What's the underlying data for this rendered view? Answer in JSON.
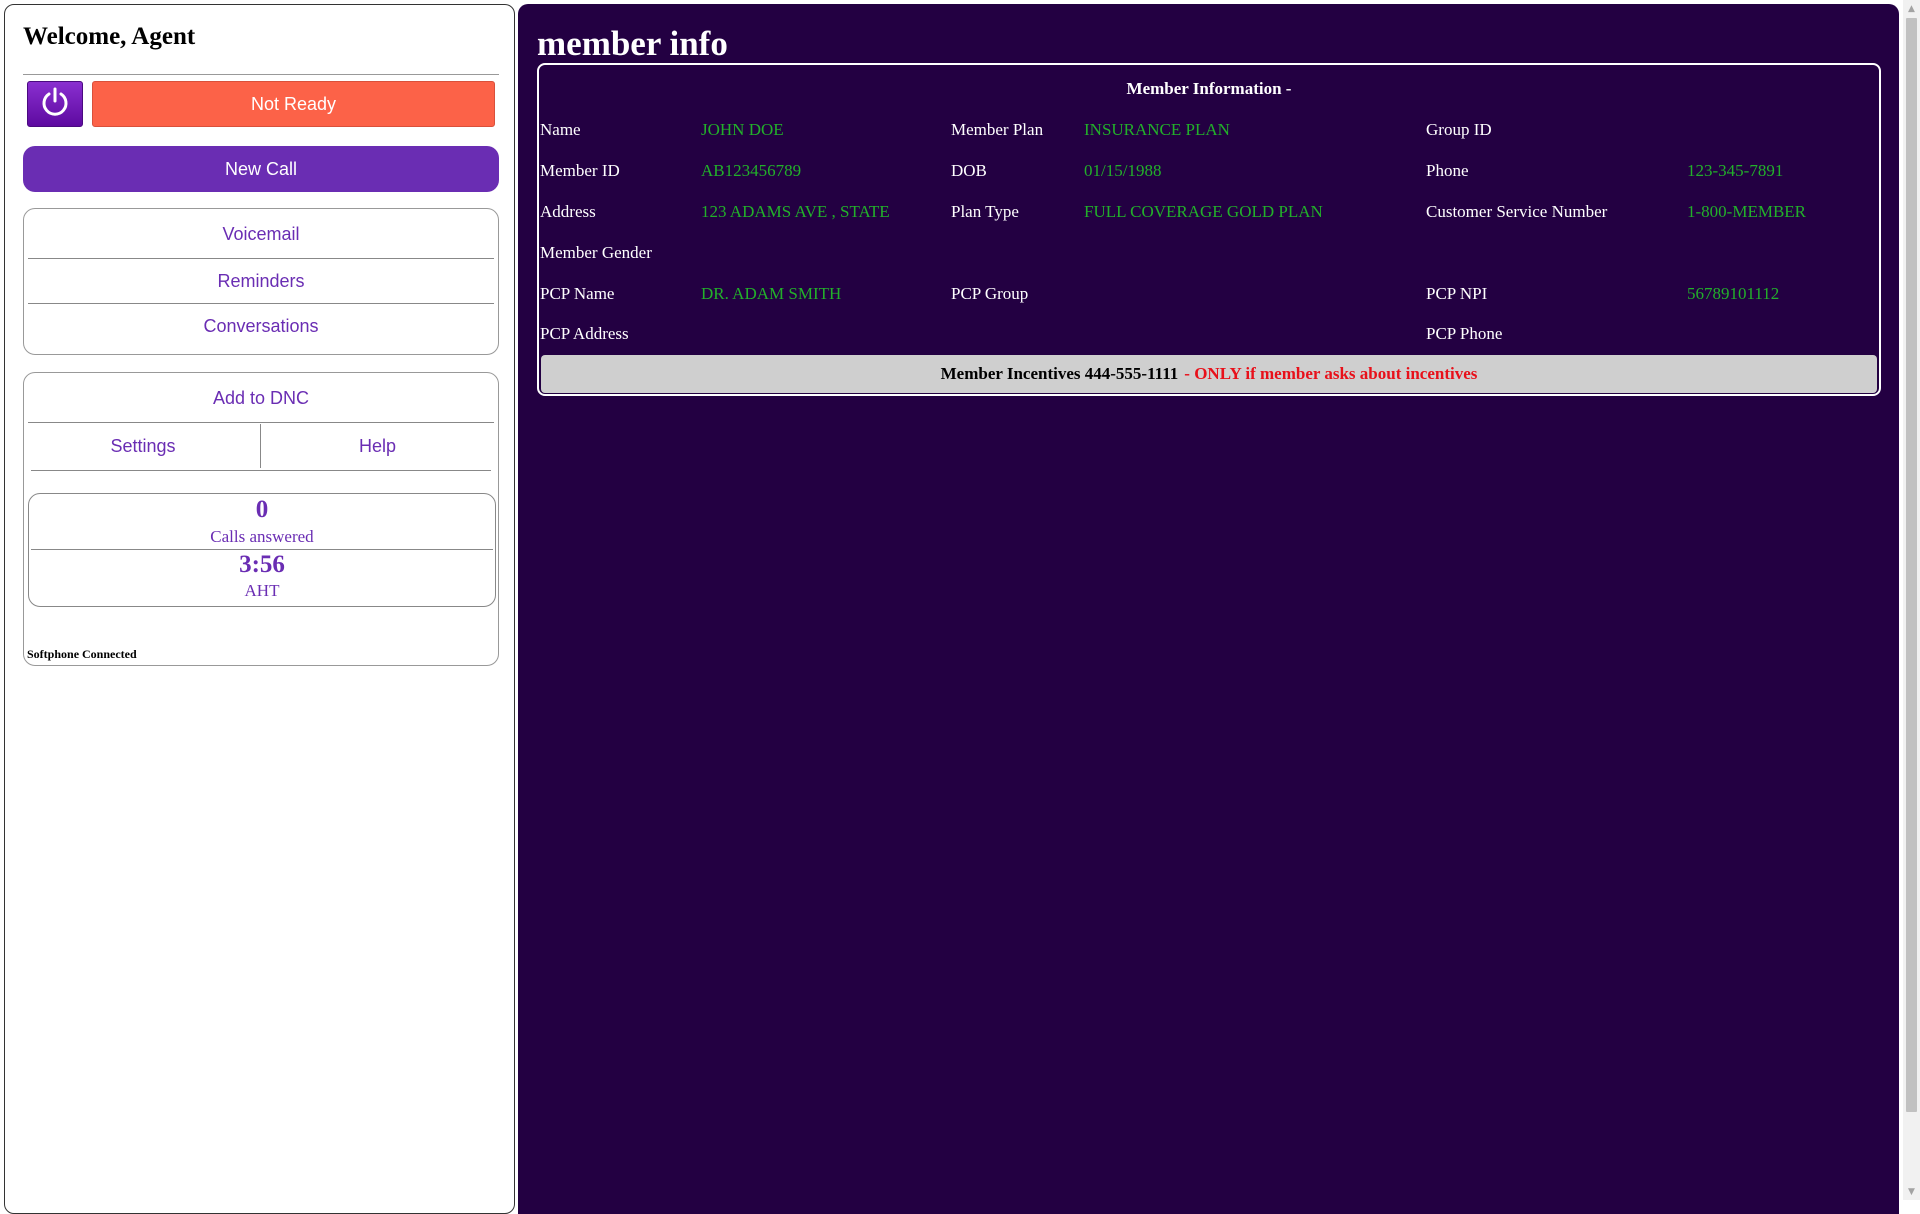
{
  "agent_panel": {
    "welcome": "Welcome, Agent",
    "status_button": "Not Ready",
    "new_call_button": "New Call",
    "menu": {
      "voicemail": "Voicemail",
      "reminders": "Reminders",
      "conversations": "Conversations"
    },
    "tools": {
      "add_dnc": "Add to DNC",
      "settings": "Settings",
      "help": "Help"
    },
    "stats": {
      "calls_answered_value": "0",
      "calls_answered_label": "Calls answered",
      "aht_value": "3:56",
      "aht_label": "AHT"
    },
    "softphone_status": "Softphone Connected",
    "colors": {
      "accent": "#6a2db3",
      "not_ready": "#fc6248",
      "power": "#7a1fc0"
    },
    "icons": {
      "power": "power-icon"
    }
  },
  "member_panel": {
    "title": "member info",
    "card_heading": "Member Information -",
    "fields": {
      "name_label": "Name",
      "name_value": "JOHN DOE",
      "member_plan_label": "Member Plan",
      "member_plan_value": "INSURANCE PLAN",
      "group_id_label": "Group ID",
      "group_id_value": "",
      "member_id_label": "Member ID",
      "member_id_value": "AB123456789",
      "dob_label": "DOB",
      "dob_value": "01/15/1988",
      "phone_label": "Phone",
      "phone_value": "123-345-7891",
      "address_label": "Address",
      "address_value": "123 ADAMS AVE , STATE",
      "plan_type_label": "Plan Type",
      "plan_type_value": "FULL COVERAGE GOLD PLAN",
      "csn_label": "Customer Service Number",
      "csn_value": "1-800-MEMBER",
      "gender_label": "Member Gender",
      "gender_value": "",
      "pcp_name_label": "PCP Name",
      "pcp_name_value": "DR. ADAM SMITH",
      "pcp_group_label": "PCP Group",
      "pcp_group_value": "",
      "pcp_npi_label": "PCP NPI",
      "pcp_npi_value": "56789101112",
      "pcp_address_label": "PCP Address",
      "pcp_address_value": "",
      "pcp_phone_label": "PCP Phone",
      "pcp_phone_value": ""
    },
    "incentives": {
      "main": "Member Incentives 444-555-1111",
      "note": "- ONLY if member asks about incentives"
    },
    "colors": {
      "background": "#230042",
      "value_text": "#22b02a",
      "warning_text": "#e8101a"
    }
  }
}
